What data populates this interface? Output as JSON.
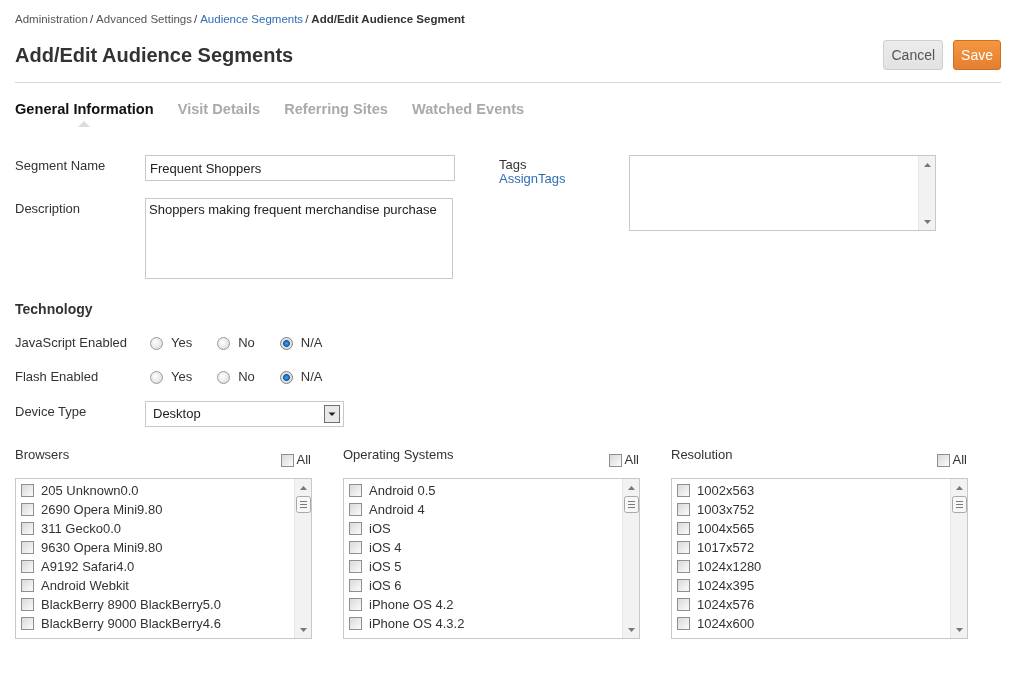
{
  "breadcrumb": [
    {
      "label": "Administration",
      "kind": "plain",
      "separator": "/"
    },
    {
      "label": "Advanced Settings",
      "kind": "plain",
      "separator": "/"
    },
    {
      "label": "Audience Segments",
      "kind": "link",
      "separator": "/"
    },
    {
      "label": "Add/Edit Audience Segment",
      "kind": "current"
    }
  ],
  "page_title": "Add/Edit Audience Segments",
  "actions": [
    {
      "label": "Cancel",
      "kind": "secondary"
    },
    {
      "label": "Save",
      "kind": "primary"
    }
  ],
  "tabs": [
    {
      "label": "General Information",
      "selected": true
    },
    {
      "label": "Visit Details",
      "selected": false
    },
    {
      "label": "Referring Sites",
      "selected": false
    },
    {
      "label": "Watched Events",
      "selected": false
    }
  ],
  "general": {
    "segment_name": {
      "label": "Segment Name",
      "value": "Frequent Shoppers"
    },
    "description": {
      "label": "Description",
      "value": "Shoppers making frequent merchandise purchase"
    },
    "tags": {
      "label": "Tags",
      "link": "AssignTags"
    }
  },
  "technology": {
    "heading": "Technology",
    "settings": [
      {
        "label": "JavaScript Enabled",
        "options": [
          {
            "label": "Yes",
            "selected": false
          },
          {
            "label": "No",
            "selected": false
          },
          {
            "label": "N/A",
            "selected": true
          }
        ]
      },
      {
        "label": "Flash Enabled",
        "options": [
          {
            "label": "Yes",
            "selected": false
          },
          {
            "label": "No",
            "selected": false
          },
          {
            "label": "N/A",
            "selected": true
          }
        ]
      }
    ],
    "device_type": {
      "label": "Device Type",
      "value": "Desktop"
    }
  },
  "lists": [
    {
      "title": "Browsers",
      "all": {
        "label": "All",
        "checked": false
      },
      "items": [
        {
          "label": "205 Unknown0.0",
          "checked": false
        },
        {
          "label": "2690 Opera Mini9.80",
          "checked": false
        },
        {
          "label": "311 Gecko0.0",
          "checked": false
        },
        {
          "label": "9630 Opera Mini9.80",
          "checked": false
        },
        {
          "label": "A9192 Safari4.0",
          "checked": false
        },
        {
          "label": "Android Webkit",
          "checked": false
        },
        {
          "label": "BlackBerry 8900 BlackBerry5.0",
          "checked": false
        },
        {
          "label": "BlackBerry 9000 BlackBerry4.6",
          "checked": false
        }
      ]
    },
    {
      "title": "Operating Systems",
      "all": {
        "label": "All",
        "checked": false
      },
      "items": [
        {
          "label": "Android 0.5",
          "checked": false
        },
        {
          "label": "Android 4",
          "checked": false
        },
        {
          "label": "iOS",
          "checked": false
        },
        {
          "label": "iOS 4",
          "checked": false
        },
        {
          "label": "iOS 5",
          "checked": false
        },
        {
          "label": "iOS 6",
          "checked": false
        },
        {
          "label": "iPhone OS 4.2",
          "checked": false
        },
        {
          "label": "iPhone OS 4.3.2",
          "checked": false
        }
      ]
    },
    {
      "title": "Resolution",
      "all": {
        "label": "All",
        "checked": false
      },
      "items": [
        {
          "label": "1002x563",
          "checked": false
        },
        {
          "label": "1003x752",
          "checked": false
        },
        {
          "label": "1004x565",
          "checked": false
        },
        {
          "label": "1017x572",
          "checked": false
        },
        {
          "label": "1024x1280",
          "checked": false
        },
        {
          "label": "1024x395",
          "checked": false
        },
        {
          "label": "1024x576",
          "checked": false
        },
        {
          "label": "1024x600",
          "checked": false
        }
      ]
    }
  ]
}
